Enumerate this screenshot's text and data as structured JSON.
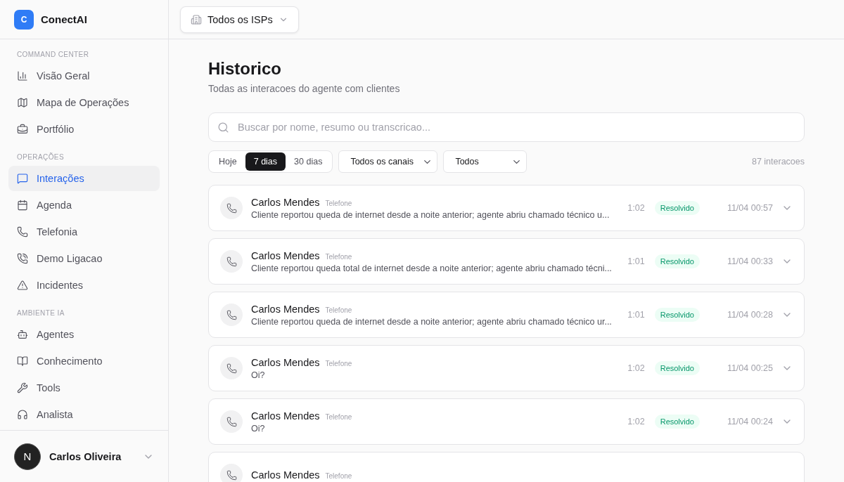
{
  "brand": {
    "initial": "C",
    "name": "ConectAI"
  },
  "sidebar": {
    "sections": [
      {
        "title": "COMMAND CENTER",
        "items": [
          {
            "label": "Visão Geral",
            "selected": false
          },
          {
            "label": "Mapa de Operações",
            "selected": false
          },
          {
            "label": "Portfólio",
            "selected": false
          }
        ]
      },
      {
        "title": "OPERAÇÕES",
        "items": [
          {
            "label": "Interações",
            "selected": true
          },
          {
            "label": "Agenda",
            "selected": false
          },
          {
            "label": "Telefonia",
            "selected": false
          },
          {
            "label": "Demo Ligacao",
            "selected": false
          },
          {
            "label": "Incidentes",
            "selected": false
          }
        ]
      },
      {
        "title": "AMBIENTE IA",
        "items": [
          {
            "label": "Agentes",
            "selected": false
          },
          {
            "label": "Conhecimento",
            "selected": false
          },
          {
            "label": "Tools",
            "selected": false
          },
          {
            "label": "Analista",
            "selected": false
          }
        ]
      }
    ]
  },
  "user": {
    "avatar_initial": "N",
    "name": "Carlos Oliveira"
  },
  "topbar": {
    "isp_selector": "Todos os ISPs"
  },
  "page": {
    "title": "Historico",
    "subtitle": "Todas as interacoes do agente com clientes"
  },
  "search": {
    "placeholder": "Buscar por nome, resumo ou transcricao..."
  },
  "periods": [
    {
      "label": "Hoje",
      "selected": false
    },
    {
      "label": "7 dias",
      "selected": true
    },
    {
      "label": "30 dias",
      "selected": false
    }
  ],
  "filters": [
    {
      "value": "Todos os canais"
    },
    {
      "value": "Todos"
    }
  ],
  "count": "87 interacoes",
  "interactions": [
    {
      "name": "Carlos Mendes",
      "channel": "Telefone",
      "summary": "Cliente reportou queda de internet desde a noite anterior; agente abriu chamado técnico u...",
      "duration": "1:02",
      "status": "Resolvido",
      "date": "11/04 00:57"
    },
    {
      "name": "Carlos Mendes",
      "channel": "Telefone",
      "summary": "Cliente reportou queda total de internet desde a noite anterior; agente abriu chamado técni...",
      "duration": "1:01",
      "status": "Resolvido",
      "date": "11/04 00:33"
    },
    {
      "name": "Carlos Mendes",
      "channel": "Telefone",
      "summary": "Cliente reportou queda de internet desde a noite anterior; agente abriu chamado técnico ur...",
      "duration": "1:01",
      "status": "Resolvido",
      "date": "11/04 00:28"
    },
    {
      "name": "Carlos Mendes",
      "channel": "Telefone",
      "summary": "Oi?",
      "duration": "1:02",
      "status": "Resolvido",
      "date": "11/04 00:25"
    },
    {
      "name": "Carlos Mendes",
      "channel": "Telefone",
      "summary": "Oi?",
      "duration": "1:02",
      "status": "Resolvido",
      "date": "11/04 00:24"
    },
    {
      "name": "Carlos Mendes",
      "channel": "Telefone"
    }
  ]
}
